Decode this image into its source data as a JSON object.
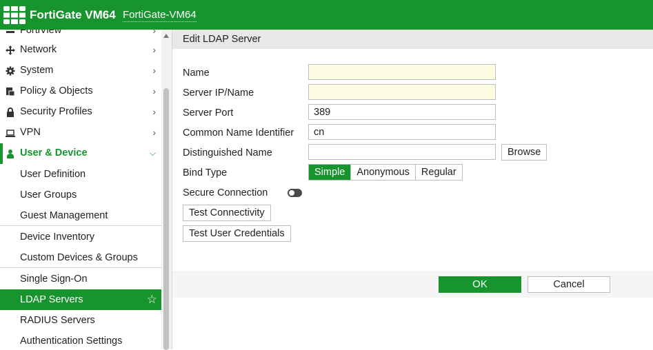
{
  "header": {
    "product_name": "FortiGate VM64",
    "hostname": "FortiGate-VM64",
    "logo_icon": "fortinet-grid-logo-icon",
    "brand_color": "#17942d"
  },
  "sidebar": {
    "items": [
      {
        "label": "FortiView",
        "icon": "fortiview-icon"
      },
      {
        "label": "Network",
        "icon": "network-arrows-icon"
      },
      {
        "label": "System",
        "icon": "gear-icon"
      },
      {
        "label": "Policy & Objects",
        "icon": "policy-icon"
      },
      {
        "label": "Security Profiles",
        "icon": "lock-icon"
      },
      {
        "label": "VPN",
        "icon": "laptop-icon"
      },
      {
        "label": "User & Device",
        "icon": "user-icon"
      }
    ],
    "subitems": [
      "User Definition",
      "User Groups",
      "Guest Management",
      "Device Inventory",
      "Custom Devices & Groups",
      "Single Sign-On",
      "LDAP Servers",
      "RADIUS Servers",
      "Authentication Settings"
    ],
    "active_subitem": "LDAP Servers"
  },
  "form": {
    "title": "Edit LDAP Server",
    "name_label": "Name",
    "name_value": "",
    "server_label": "Server IP/Name",
    "server_value": "",
    "port_label": "Server Port",
    "port_value": "389",
    "cn_label": "Common Name Identifier",
    "cn_value": "cn",
    "dn_label": "Distinguished Name",
    "dn_value": "",
    "browse_label": "Browse",
    "bind_label": "Bind Type",
    "bind_options": [
      "Simple",
      "Anonymous",
      "Regular"
    ],
    "bind_selected": "Simple",
    "secure_label": "Secure Connection",
    "secure_enabled": false,
    "test_conn_label": "Test Connectivity",
    "test_user_label": "Test User Credentials",
    "ok_label": "OK",
    "cancel_label": "Cancel"
  }
}
